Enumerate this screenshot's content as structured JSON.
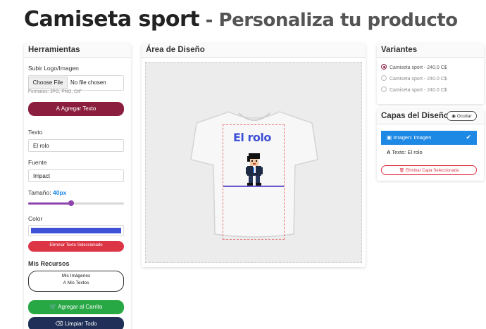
{
  "header": {
    "product": "Camiseta sport",
    "subtitle": "Personaliza tu producto",
    "separator": " - "
  },
  "tools": {
    "title": "Herramientas",
    "logo_label": "Subir Logo/Imagen",
    "file_button": "Choose File",
    "file_status": "No file chosen",
    "formats": "Formatos: JPG, PNG, GIF",
    "add_text_button": "Agregar Texto",
    "text_label": "Texto",
    "text_value": "El rolo",
    "font_label": "Fuente",
    "font_value": "Impact",
    "size_label": "Tamaño:",
    "size_value": "40px",
    "size_fraction": 0.45,
    "color_label": "Color",
    "color_value": "#3f51d6",
    "delete_text_button": "Eliminar Texto Seleccionado",
    "resources_title": "Mis Recursos",
    "my_images": "Mis Imágenes",
    "my_texts": "Mis Textos",
    "add_to_cart": "Agregar al Carrito",
    "clear_all": "Limpiar Todo",
    "colors": {
      "maroon": "#8b1e3f",
      "red": "#dc3545",
      "green": "#28a745",
      "navy": "#1f2f57"
    }
  },
  "design": {
    "title": "Área de Diseño",
    "text_on_shirt": "El rolo"
  },
  "variants": {
    "title": "Variantes",
    "items": [
      {
        "label": "Camiseta sport - 240.0 C$",
        "selected": true
      },
      {
        "label": "Camiseta sport - 240.0 C$",
        "selected": false
      },
      {
        "label": "Camiseta sport - 240.0 C$",
        "selected": false
      }
    ]
  },
  "layers": {
    "title": "Capas del Diseño",
    "toggle_button": "Ocultar",
    "items": [
      {
        "label": "Imagen: Imagen",
        "active": true
      },
      {
        "label": "Texto: El rolo",
        "active": false
      }
    ],
    "delete_button": "Eliminar Capa Seleccionada",
    "active_color": "#1e88e5"
  }
}
